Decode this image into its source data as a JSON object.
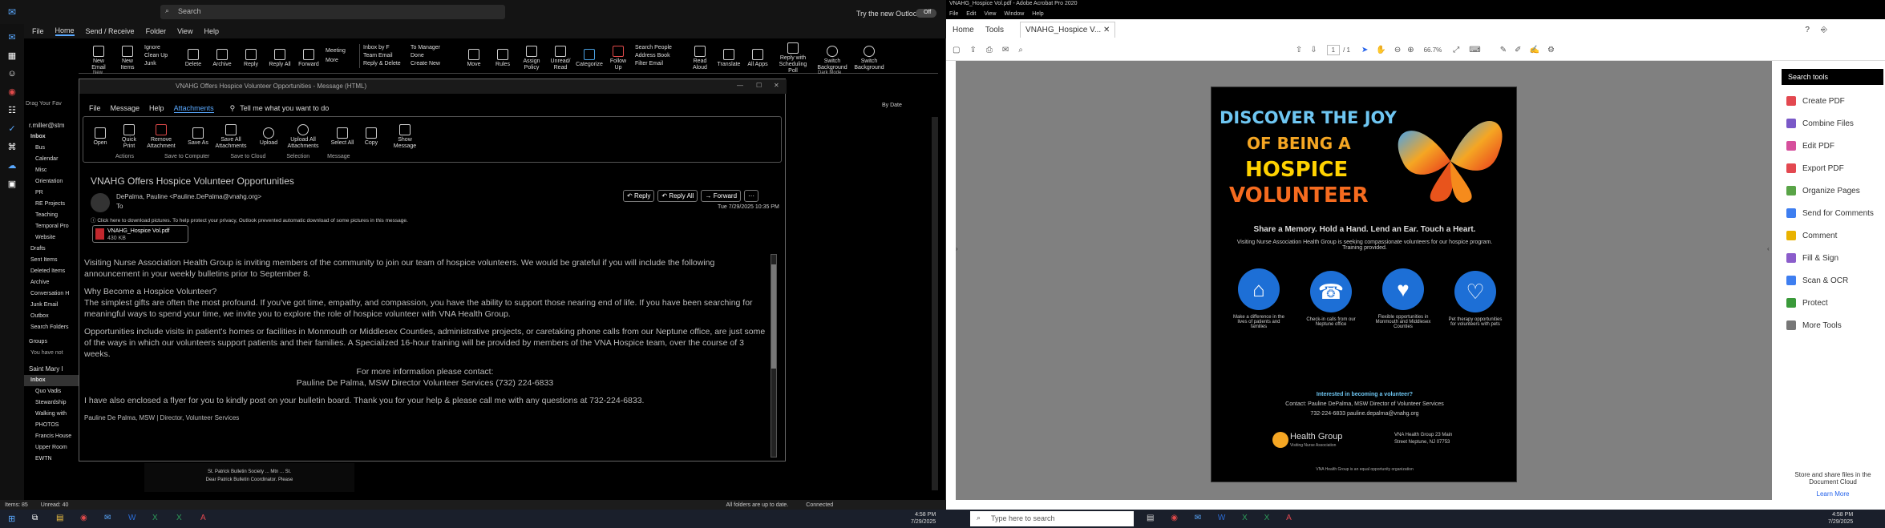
{
  "outlook": {
    "search": "Search",
    "try_new": "Try the new Outlook",
    "toggle": "Off",
    "tabs": [
      "File",
      "Home",
      "Send / Receive",
      "Folder",
      "View",
      "Help"
    ],
    "ribbon": [
      "New Email",
      "New Items",
      "Ignore",
      "Clean Up",
      "Junk",
      "Delete",
      "Archive",
      "Reply",
      "Reply All",
      "Forward",
      "Meeting",
      "More",
      "Inbox by F",
      "Team Email",
      "Reply & Delete",
      "To Manager",
      "Done",
      "Create New",
      "Move",
      "Rules",
      "Assign Policy",
      "Unread/ Read",
      "Categorize",
      "Follow Up",
      "Search People",
      "Address Book",
      "Filter Email",
      "Read Aloud",
      "Translate",
      "All Apps",
      "Reply with Scheduling Poll",
      "Switch Background",
      "Switch Background"
    ],
    "ribbon_groups": [
      "New",
      "Dark Mode"
    ],
    "drop_text": "Drag Your Fav",
    "account": "r.miller@stm",
    "folders": [
      "Inbox",
      "Bus",
      "Calendar",
      "Misc",
      "Orientation",
      "PR",
      "RE Projects",
      "Teaching",
      "Temporal Pro",
      "Website",
      "Drafts",
      "Sent Items",
      "Deleted Items",
      "Archive",
      "Conversation H",
      "Junk Email",
      "Outbox",
      "Search Folders"
    ],
    "groups_label": "Groups",
    "groups_note": "You have not",
    "account2": "Saint Mary I",
    "folders2": [
      "Inbox",
      "Quo Vadis",
      "Stewardship",
      "Walking with",
      "PHOTOS",
      "Francis House",
      "Upper Room",
      "EWTN"
    ],
    "sort": "By Date",
    "status_items": "Items: 85",
    "status_unread": "Unread: 40",
    "status_sync": "All folders are up to date.",
    "status_conn": "Connected",
    "preview_line1": "St. Patrick Bulletin Society ... Mtn ... St.",
    "preview_line2": "Dear Patrick Bulletin Coordinator. Please"
  },
  "message": {
    "window_title": "VNAHG Offers Hospice Volunteer Opportunities  -  Message (HTML)",
    "tabs": [
      "File",
      "Message",
      "Help",
      "Attachments"
    ],
    "tell_me": "Tell me what you want to do",
    "ribbon": [
      "Open",
      "Quick Print",
      "Remove Attachment",
      "Save As",
      "Save All Attachments",
      "Upload",
      "Upload All Attachments",
      "Select All",
      "Copy",
      "Show Message"
    ],
    "ribbon_groups": [
      "Actions",
      "Save to Computer",
      "Save to Cloud",
      "Selection",
      "Message"
    ],
    "subject": "VNAHG Offers Hospice Volunteer Opportunities",
    "from": "DePalma, Pauline <Pauline.DePalma@vnahg.org>",
    "to_label": "To",
    "buttons": [
      "Reply",
      "Reply All",
      "Forward"
    ],
    "date": "Tue 7/29/2025 10:35 PM",
    "info_bar": "Click here to download pictures. To help protect your privacy, Outlook prevented automatic download of some pictures in this message.",
    "attachment_name": "VNAHG_Hospice Vol.pdf",
    "attachment_size": "430 KB",
    "body": [
      "Visiting Nurse Association Health Group is inviting members of the community to join our team of hospice volunteers. We would be grateful if you will include the following announcement in your weekly bulletins prior to September 8.",
      "Why Become a Hospice Volunteer?",
      "The simplest gifts are often the most profound. If you've got time, empathy, and compassion, you have the ability to support those nearing end of life. If you have been searching for meaningful ways to spend your time, we invite you to explore the role of hospice volunteer with VNA Health Group.",
      "Opportunities include visits in patient's homes or facilities in Monmouth or Middlesex Counties, administrative projects, or caretaking phone calls from our Neptune office, are just some of the ways in which our volunteers support patients and their families. A Specialized 16-hour training will be provided by members of the VNA Hospice team, over the course of 3 weeks.",
      "For more information please contact:",
      "Pauline De Palma, MSW Director Volunteer Services (732) 224-6833",
      "I have also enclosed a flyer for you to kindly post on your bulletin board. Thank you for your help & please call me with any questions at 732-224-6833.",
      "Pauline De Palma, MSW | Director, Volunteer Services"
    ]
  },
  "acrobat": {
    "title": "VNAHG_Hospice Vol.pdf - Adobe Acrobat Pro 2020",
    "menu": [
      "File",
      "Edit",
      "View",
      "Window",
      "Help"
    ],
    "tabs": [
      "Home",
      "Tools",
      "VNAHG_Hospice V..."
    ],
    "page": "1",
    "pages": "/ 1",
    "zoom": "66.7%",
    "tools": [
      "Search tools",
      "Create PDF",
      "Combine Files",
      "Edit PDF",
      "Export PDF",
      "Organize Pages",
      "Send for Comments",
      "Comment",
      "Fill & Sign",
      "Scan & OCR",
      "Protect",
      "More Tools"
    ],
    "tool_colors": [
      "#e34850",
      "#7a59c8",
      "#d64f9c",
      "#e34850",
      "#59a447",
      "#3e7ef0",
      "#e9b200",
      "#8b5dcb",
      "#3e7ef0",
      "#3a9a3a",
      "#777777"
    ],
    "cloud_note": "Store and share files in the Document Cloud",
    "learn_more": "Learn More",
    "flyer": {
      "line1": "DISCOVER THE JOY",
      "line2": "OF BEING A",
      "line3": "HOSPICE",
      "line4": "VOLUNTEER",
      "tagline": "Share a Memory. Hold a Hand. Lend an Ear. Touch a Heart.",
      "intro": "Visiting Nurse Association Health Group is seeking compassionate volunteers for our hospice program. Training provided.",
      "icons": [
        {
          "name": "home-heart-icon",
          "text": "Make a difference in the lives of patients and families"
        },
        {
          "name": "phone-heart-icon",
          "text": "Check-in calls from our Neptune office"
        },
        {
          "name": "hands-heart-icon",
          "text": "Flexible opportunities in Monmouth and Middlesex Counties"
        },
        {
          "name": "dog-heart-icon",
          "text": "Pet therapy opportunities for volunteers with pets"
        }
      ],
      "interest": "Interested in becoming a volunteer?",
      "contact": "Contact: Pauline DePalma, MSW Director of Volunteer Services",
      "phone": "732-224-6833   pauline.depalma@vnahg.org",
      "org": "Health Group",
      "org_sub": "Visiting Nurse Association",
      "address": "VNA Health Group  23 Main Street  Neptune, NJ 07753",
      "footer": "VNA Health Group is an equal opportunity organization"
    }
  },
  "taskbar": {
    "search": "Type here to search",
    "time1": "4:58 PM",
    "date1": "7/29/2025",
    "time2": "4:58 PM",
    "date2": "7/29/2025"
  }
}
